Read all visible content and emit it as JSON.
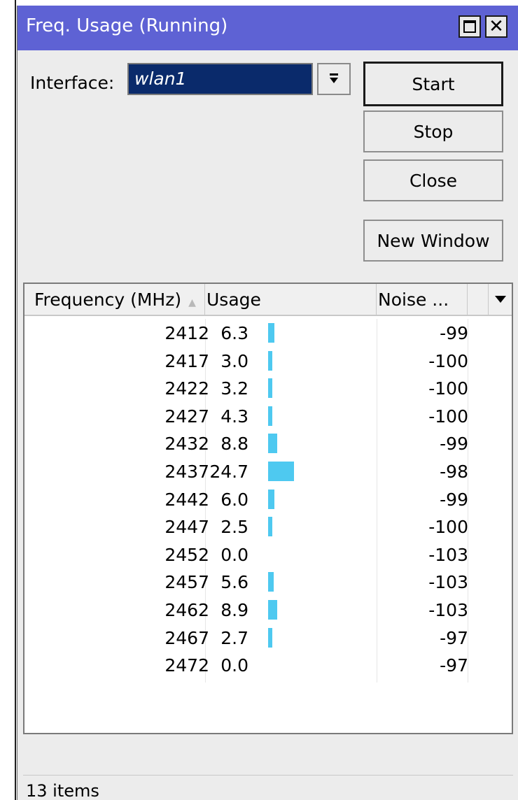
{
  "window": {
    "title": "Freq. Usage (Running)",
    "close_glyph": "✕"
  },
  "form": {
    "interface_label": "Interface:",
    "interface_value": "wlan1"
  },
  "buttons": {
    "start": "Start",
    "stop": "Stop",
    "close": "Close",
    "new_window": "New Window"
  },
  "table": {
    "columns": {
      "frequency": "Frequency (MHz)",
      "usage": "Usage",
      "noise": "Noise ..."
    },
    "rows": [
      {
        "freq": "2412",
        "usage": "6.3",
        "noise": "-99"
      },
      {
        "freq": "2417",
        "usage": "3.0",
        "noise": "-100"
      },
      {
        "freq": "2422",
        "usage": "3.2",
        "noise": "-100"
      },
      {
        "freq": "2427",
        "usage": "4.3",
        "noise": "-100"
      },
      {
        "freq": "2432",
        "usage": "8.8",
        "noise": "-99"
      },
      {
        "freq": "2437",
        "usage": "24.7",
        "noise": "-98"
      },
      {
        "freq": "2442",
        "usage": "6.0",
        "noise": "-99"
      },
      {
        "freq": "2447",
        "usage": "2.5",
        "noise": "-100"
      },
      {
        "freq": "2452",
        "usage": "0.0",
        "noise": "-103"
      },
      {
        "freq": "2457",
        "usage": "5.6",
        "noise": "-103"
      },
      {
        "freq": "2462",
        "usage": "8.9",
        "noise": "-103"
      },
      {
        "freq": "2467",
        "usage": "2.7",
        "noise": "-97"
      },
      {
        "freq": "2472",
        "usage": "0.0",
        "noise": "-97"
      }
    ]
  },
  "status": {
    "items_count": "13 items"
  },
  "colors": {
    "titlebar": "#5e62d4",
    "usage_bar": "#4ec9f0",
    "selected_input": "#0a2a6b"
  },
  "icons": {
    "dropdown": "dropdown-arrow-icon",
    "sort": "sort-ascending-icon",
    "column_menu": "column-menu-icon",
    "maximize": "maximize-icon",
    "close": "close-icon"
  }
}
